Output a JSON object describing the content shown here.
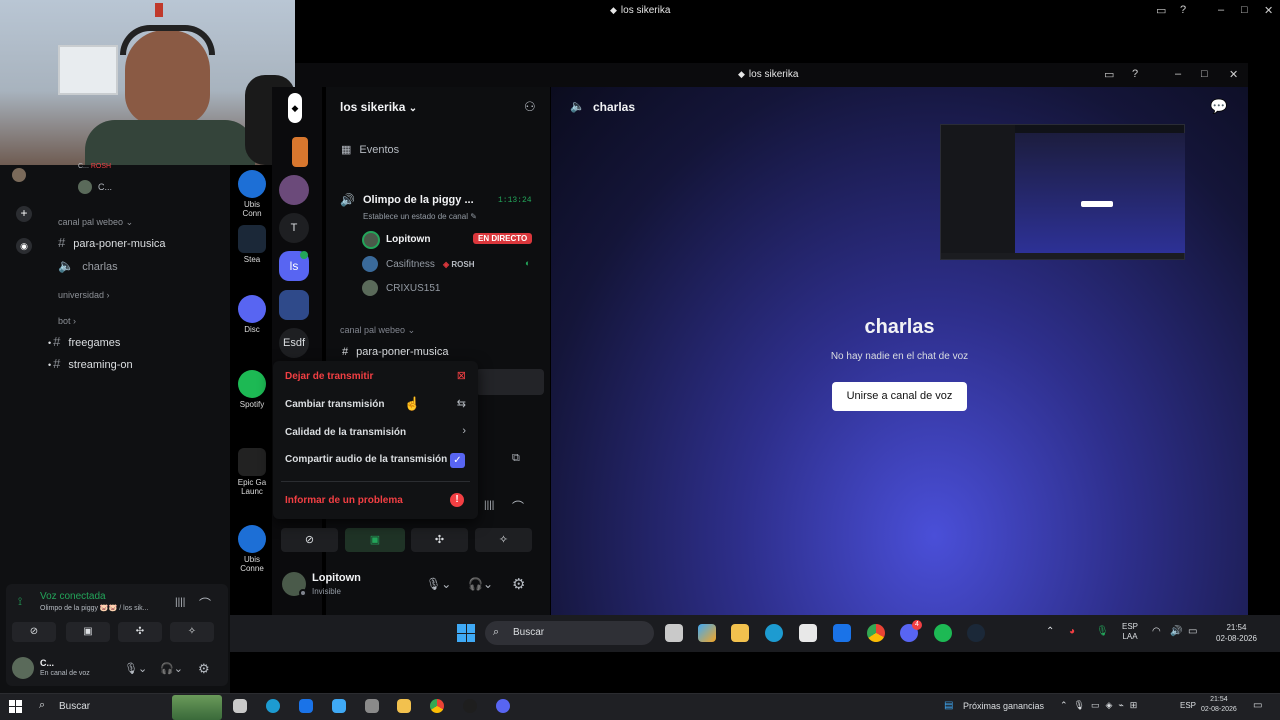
{
  "outer_window": {
    "title": "los sikerika"
  },
  "host_sidebar": {
    "rows_top": [
      "C...",
      "ROSH",
      "C..."
    ],
    "category_webeo": "canal pal webeo",
    "channel_music": "para-poner-musica",
    "channel_charlas": "charlas",
    "category_universidad": "universidad",
    "category_bot": "bot",
    "channel_freegames": "freegames",
    "channel_streaming": "streaming-on",
    "voice_status": "Voz conectada",
    "voice_sub": "Olimpo de la piggy 🐷🐷 / los sik...",
    "user_name": "C...",
    "user_status": "En canal de voz"
  },
  "desktop_apps": {
    "ubisoft_1": "Ubis Conn",
    "steam": "Stea",
    "discord": "Disc",
    "spotify": "Spotify",
    "epic": "Epic Ga Launc",
    "ubisoft_2": "Ubis Conne"
  },
  "inner_window": {
    "title": "los sikerika"
  },
  "servers": {
    "t": "T",
    "ls": "ls",
    "esdf": "Esdf"
  },
  "channels": {
    "server_name": "los sikerika",
    "events": "Eventos",
    "voice_channel": "Olimpo de la piggy ...",
    "voice_time": "1:13:24",
    "voice_sub": "Establece un estado de canal",
    "member_1": "Lopitown",
    "member_1_badge": "EN DIRECTO",
    "member_2": "Casifitness",
    "member_2_tag": "ROSH",
    "member_3": "CRIXUS151",
    "category": "canal pal webeo",
    "channel_music": "para-poner-musica",
    "user_name": "Lopitown",
    "user_status": "Invisible"
  },
  "context_menu": {
    "stop": "Dejar de transmitir",
    "change": "Cambiar transmisión",
    "quality": "Calidad de la transmisión",
    "share_audio": "Compartir audio de la transmisión",
    "report": "Informar de un problema"
  },
  "main": {
    "header_channel": "charlas",
    "title": "charlas",
    "subtitle": "No hay nadie en el chat de voz",
    "join_button": "Unirse a canal de voz"
  },
  "inner_taskbar": {
    "search": "Buscar",
    "lang_1": "ESP",
    "lang_2": "LAA",
    "time": "21:54",
    "date": "02-08-2026",
    "discord_badge": "4"
  },
  "bottom_taskbar": {
    "search": "Buscar",
    "widget": "Próximas ganancias",
    "lang": "ESP",
    "time": "21:54",
    "date": "02-08-2026"
  },
  "colors": {
    "live_red": "#da373c",
    "danger_text": "#f23f43",
    "blurple": "#5865f2",
    "voice_green": "#23a55a"
  }
}
